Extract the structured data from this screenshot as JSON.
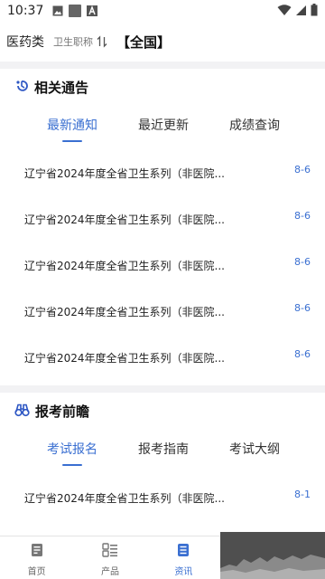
{
  "status_bar": {
    "time": "10:37"
  },
  "topbar": {
    "category": "医药类",
    "subcategory": "卫生职称",
    "region": "【全国】"
  },
  "notice": {
    "title": "相关通告",
    "tabs": [
      "最新通知",
      "最近更新",
      "成绩查询"
    ],
    "active_tab": 0,
    "rows": [
      {
        "title": "辽宁省2024年度全省卫生系列（非医院...",
        "date": "8-6"
      },
      {
        "title": "辽宁省2024年度全省卫生系列（非医院...",
        "date": "8-6"
      },
      {
        "title": "辽宁省2024年度全省卫生系列（非医院...",
        "date": "8-6"
      },
      {
        "title": "辽宁省2024年度全省卫生系列（非医院...",
        "date": "8-6"
      },
      {
        "title": "辽宁省2024年度全省卫生系列（非医院...",
        "date": "8-6"
      }
    ]
  },
  "outlook": {
    "title": "报考前瞻",
    "tabs": [
      "考试报名",
      "报考指南",
      "考试大纲"
    ],
    "active_tab": 0,
    "rows": [
      {
        "title": "辽宁省2024年度全省卫生系列（非医院...",
        "date": "8-1"
      }
    ]
  },
  "bottom_nav": {
    "items": [
      {
        "label": "首页",
        "icon": "home-icon"
      },
      {
        "label": "产品",
        "icon": "product-grid-icon"
      },
      {
        "label": "资讯",
        "icon": "news-icon"
      }
    ],
    "active": 2
  },
  "colors": {
    "accent": "#3a6fd1",
    "background": "#f2f2f4"
  }
}
